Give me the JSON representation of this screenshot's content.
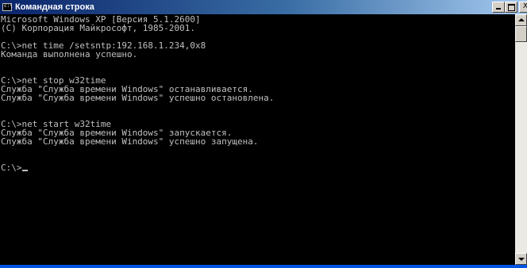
{
  "window": {
    "title": "Командная строка",
    "icon_text": "c:\\",
    "icon": "console-icon",
    "buttons": {
      "minimize": "minimize-icon",
      "maximize": "maximize-icon",
      "close": "close-icon",
      "close_label": "X"
    },
    "colors": {
      "title_start": "#0a246a",
      "title_end": "#a6caf0",
      "console_bg": "#000000",
      "console_fg": "#c0c0c0"
    }
  },
  "console": {
    "lines": [
      "Microsoft Windows XP [Версия 5.1.2600]",
      "(С) Корпорация Майкрософт, 1985-2001.",
      "",
      "C:\\>net time /setsntp:192.168.1.234,0x8",
      "Команда выполнена успешно.",
      "",
      "",
      "C:\\>net stop w32time",
      "Служба \"Служба времени Windows\" останавливается.",
      "Служба \"Служба времени Windows\" успешно остановлена.",
      "",
      "",
      "C:\\>net start w32time",
      "Служба \"Служба времени Windows\" запускается.",
      "Служба \"Служба времени Windows\" успешно запущена.",
      "",
      "",
      "C:\\>"
    ]
  }
}
